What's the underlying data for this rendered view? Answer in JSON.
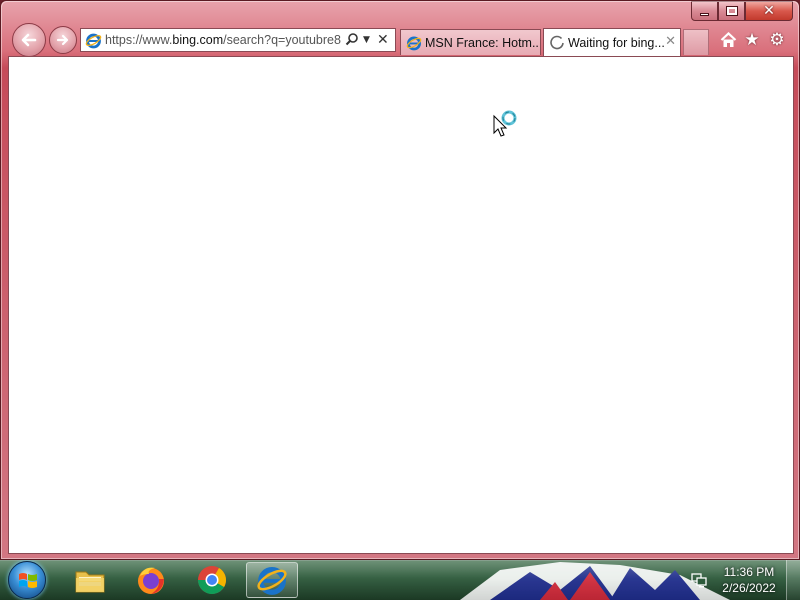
{
  "window": {
    "controls": {
      "minimize": "minimize",
      "maximize": "maximize",
      "close": "close"
    }
  },
  "navigation": {
    "back_icon": "back-arrow-icon",
    "forward_icon": "forward-arrow-icon"
  },
  "address_bar": {
    "url_prefix": "https://www.",
    "url_domain": "bing.com",
    "url_rest": "/search?q=youtubre8",
    "search_icon": "search-icon",
    "dropdown_icon": "chevron-down-icon",
    "stop_icon": "close-icon"
  },
  "tabs": [
    {
      "title": "MSN France: Hotm...",
      "icon": "ie-icon",
      "active": false
    },
    {
      "title": "Waiting for bing...",
      "icon": "loading-spinner-icon",
      "active": true
    }
  ],
  "toolbar": {
    "home_icon": "home-icon",
    "favorites_icon": "star-icon",
    "tools_icon": "gear-icon"
  },
  "taskbar": {
    "start_icon": "windows-start-icon",
    "pinned": [
      {
        "name": "Windows Explorer",
        "icon": "folder-icon"
      },
      {
        "name": "Firefox",
        "icon": "firefox-icon"
      },
      {
        "name": "Chrome",
        "icon": "chrome-icon"
      },
      {
        "name": "Internet Explorer",
        "icon": "ie-icon",
        "active": true
      }
    ],
    "tray": {
      "network_icon": "network-icon",
      "time": "11:36 PM",
      "date": "2/26/2022"
    }
  },
  "colors": {
    "frame": "#d96f7b",
    "taskbar": "#2c5a3a",
    "content": "#ffffff"
  }
}
